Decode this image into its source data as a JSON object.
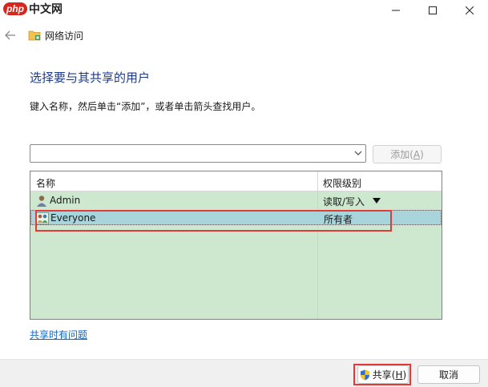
{
  "watermark": {
    "brand": "php",
    "site": "中文网"
  },
  "nav": {
    "title": "网络访问"
  },
  "heading": "选择要与其共享的用户",
  "instruction": "键入名称，然后单击“添加”，或者单击箭头查找用户。",
  "combo": {
    "value": "",
    "placeholder": ""
  },
  "add_button": {
    "label": "添加",
    "accel": "A"
  },
  "list": {
    "columns": [
      "名称",
      "权限级别"
    ],
    "rows": [
      {
        "name": "Admin",
        "permission": "读取/写入",
        "icon": "user-icon",
        "has_dropdown": true
      },
      {
        "name": "Everyone",
        "permission": "所有者",
        "icon": "group-icon",
        "selected": true
      }
    ]
  },
  "help_link": "共享时有问题",
  "share_button": {
    "label": "共享",
    "accel": "H"
  },
  "cancel_button": {
    "label": "取消"
  },
  "colors": {
    "heading": "#1e3a8a",
    "list_background": "#cde8cf",
    "selected_row": "#a8d4dc",
    "highlight": "#e53935",
    "link": "#1565c0"
  }
}
